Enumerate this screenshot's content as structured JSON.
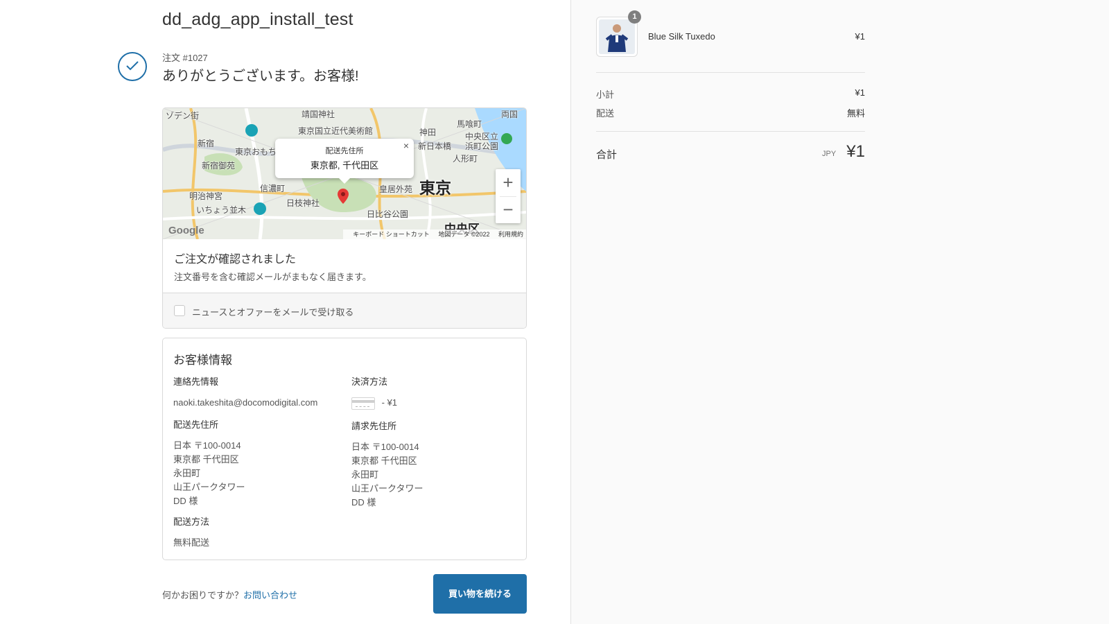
{
  "store": {
    "title": "dd_adg_app_install_test"
  },
  "order": {
    "number": "注文 #1027",
    "thanks": "ありがとうございます。お客様!"
  },
  "map": {
    "popup_title": "配送先住所",
    "popup_address": "東京都, 千代田区",
    "popup_close": "×",
    "zoom_in": "+",
    "zoom_out": "−",
    "google": "Google",
    "footer": {
      "shortcuts": "キーボード ショートカット",
      "data": "地図データ ©2022",
      "terms": "利用規約"
    },
    "labels": {
      "jingu": "ゾデン街",
      "yasukuni": "靖国神社",
      "kokuritsu": "東京国立近代美術館",
      "shinjuku": "新宿",
      "gyoen": "新宿御苑",
      "jingumae": "明治神宮",
      "ichou": "いちょう並木",
      "shinanomachi": "信濃町",
      "hie": "日枝神社",
      "kokyo": "皇居外苑",
      "hibiya": "日比谷公園",
      "kanda": "神田",
      "nihonbashi": "新日本橋",
      "bakuro": "馬喰町",
      "hamacho": "浜町公園",
      "ningyo": "人形町",
      "ryogoku": "両国",
      "tokyo": "東京",
      "chuo": "中央区",
      "nakasu": "中央区立",
      "omote": "東京おもち"
    }
  },
  "confirmation": {
    "title": "ご注文が確認されました",
    "text": "注文番号を含む確認メールがまもなく届きます。"
  },
  "newsletter": {
    "label": "ニュースとオファーをメールで受け取る"
  },
  "customer": {
    "title": "お客様情報",
    "contact_label": "連絡先情報",
    "contact_value": "naoki.takeshita@docomodigital.com",
    "payment_label": "決済方法",
    "payment_value": "- ¥1",
    "shipping_label": "配送先住所",
    "shipping_lines": [
      "日本 〒100-0014",
      "東京都 千代田区",
      "永田町",
      "山王パークタワー",
      "DD 様"
    ],
    "billing_label": "請求先住所",
    "billing_lines": [
      "日本 〒100-0014",
      "東京都 千代田区",
      "永田町",
      "山王パークタワー",
      "DD 様"
    ],
    "method_label": "配送方法",
    "method_value": "無料配送"
  },
  "footer": {
    "help_text": "何かお困りですか？",
    "help_link": "お問い合わせ",
    "continue_button": "買い物を続ける"
  },
  "cart": {
    "items": [
      {
        "name": "Blue Silk Tuxedo",
        "price": "¥1",
        "quantity": "1"
      }
    ],
    "subtotal_label": "小計",
    "subtotal_value": "¥1",
    "shipping_label": "配送",
    "shipping_value": "無料",
    "total_label": "合計",
    "total_currency": "JPY",
    "total_value": "¥1"
  },
  "colors": {
    "accent": "#1f6fa8",
    "pin": "#e53935"
  }
}
